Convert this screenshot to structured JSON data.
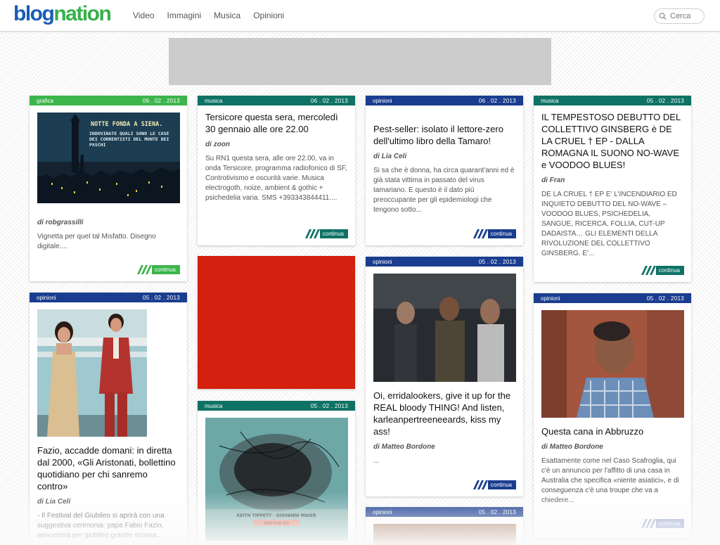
{
  "header": {
    "logo_left": "blog",
    "logo_right": "nation",
    "nav": [
      "Video",
      "Immagini",
      "Musica",
      "Opinioni"
    ],
    "search_placeholder": "Cerca"
  },
  "colors": {
    "grafica": "#3cb54b",
    "musica": "#0f7265",
    "opinioni": "#1a3d8f",
    "ad_red": "#d4200f",
    "banner": "#cccccc"
  },
  "continue_label": "continua",
  "cards": [
    {
      "category": "grafica",
      "date": "06 . 02 . 2013",
      "image": "illustration-notte-fonda-siena",
      "image_caption": "NOTTE FONDA A SIENA.",
      "image_text": "INDOVINATE QUALI SONO LE CASE DEI CORRENTISTI DEL MONTE DEI PASCHI",
      "author": "di robgrassilli",
      "excerpt": "Vignetta per quel tal Misfatto. Disegno digitale...."
    },
    {
      "category": "musica",
      "date": "06 . 02 . 2013",
      "title": "Tersicore questa sera, mercoledì 30 gennaio alle ore 22.00",
      "author": "di zoon",
      "excerpt": "Su RN1 questa sera, alle ore 22.00, va in onda Tersicore, programma radiofonico di SF, Controtivismo e oscurità varie. Musica electrogoth, noize, ambient & gothic + psichedelia varia. SMS +393343844411...."
    },
    {
      "category": "opinioni",
      "date": "06 . 02 . 2013",
      "title": "Pest-seller: isolato il lettore-zero dell'ultimo libro della Tamaro!",
      "author": "di Lia Celi",
      "excerpt": "Si sa che è donna, ha circa quarant'anni ed è già stata vittima in passato del virus tamariano. E questo è il dato più preoccupante per gli epidemiologi che tengono sotto..."
    },
    {
      "category": "musica",
      "date": "05 . 02 . 2013",
      "title": "IL TEMPESTOSO DEBUTTO DEL COLLETTIVO GINSBERG è DE LA CRUEL † EP - DALLA ROMAGNA IL SUONO NO-WAVE e VOODOO BLUES!",
      "author": "di Fran",
      "excerpt": "DE LA CRUEL † EP E' L'INCENDIARIO ED INQUIETO DEBUTTO DEL NO-WAVE – VOODOO BLUES, PSICHEDELIA, SANGUE, RICERCA, FOLLIA, CUT-UP DADAISTA… GLI ELEMENTI DELLA RIVOLUZIONE DEL COLLETTIVO GINSBERG.  E'..."
    },
    {
      "category": "opinioni",
      "date": "05 . 02 . 2013",
      "image": "photo-presenters-stage",
      "title": "Fazio, accadde domani: in diretta dal 2000, «Gli Aristonati, bollettino quotidiano per chi sanremo contro»",
      "author": "di Lia Celi",
      "excerpt": "- Il Festival del Giubileo si aprirà con una suggestiva cerimonia: papa Fabio Fazio, annuncerà per giubileo grande scossa..."
    },
    {
      "category": "musica",
      "date": "05 . 02 . 2013",
      "image": "album-cover-keith-tippett",
      "image_text": "KEITH TIPPETT · GIOVANNI MAIER",
      "image_text2": "TWO FOR JOY"
    },
    {
      "category": "opinioni",
      "date": "05 . 02 . 2013",
      "image": "movie-still-fast-and-furious",
      "title": "Oi, erridalookers, give it up for the REAL bloody THING! And listen, karleanpertreeneeards, kiss my ass!",
      "author": "di Matteo Bordone",
      "excerpt": "..."
    },
    {
      "category": "opinioni",
      "date": "05 . 02 . 2013",
      "image": "photo-man-interview",
      "title": "Questa cana in Abbruzzo",
      "author": "di Matteo Bordone",
      "excerpt": "Esattamente come nel Caso Scafroglia, qui c'è un annuncio per l'affitto di una casa in Australia che specifica «niente asiatici», e di conseguenza c'è una troupe che va a chiedere..."
    },
    {
      "category": "opinioni",
      "date": "05 . 02 . 2013"
    }
  ]
}
